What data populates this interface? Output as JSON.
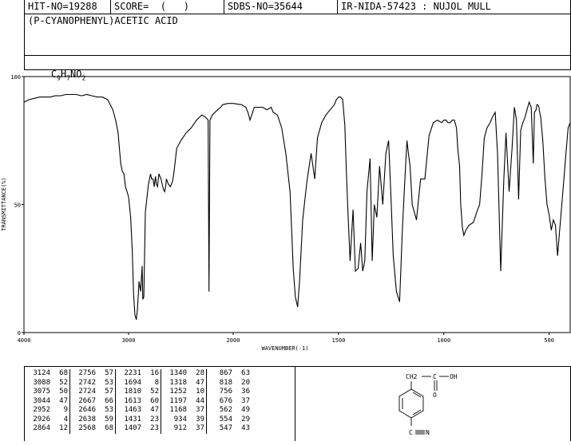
{
  "header": {
    "hit_no": "HIT-NO=19288",
    "score": "SCORE=  (   )",
    "sdbs_no": "SDBS-NO=35644",
    "ir_info": "IR-NIDA-57423 : NUJOL MULL"
  },
  "compound": {
    "name": "(P-CYANOPHENYL)ACETIC ACID",
    "formula": "C9H7NO2",
    "formula_parts": [
      "C",
      "9",
      "H",
      "7",
      "NO",
      "2"
    ]
  },
  "structure": {
    "ch2_label": "CH2",
    "c_label": "C",
    "oh_label": "OH",
    "o_label": "O",
    "c_nitrile": "C",
    "n_label": "N"
  },
  "chart_data": {
    "type": "line",
    "xlabel": "WAVENUMBER(-1)",
    "ylabel": "TRANSMITTANCE(%)",
    "xlim": [
      4000,
      400
    ],
    "ylim": [
      0,
      100
    ],
    "x_ticks": [
      "4000",
      "3000",
      "2000",
      "1500",
      "1000",
      "500"
    ],
    "y_ticks": [
      "100",
      "50",
      "0"
    ],
    "x_tick_values": [
      4000,
      3000,
      2000,
      1500,
      1000,
      500
    ],
    "y_tick_values": [
      100,
      50,
      0
    ],
    "x": [
      4000,
      3950,
      3900,
      3850,
      3800,
      3750,
      3700,
      3650,
      3600,
      3550,
      3500,
      3450,
      3400,
      3350,
      3300,
      3250,
      3200,
      3150,
      3124,
      3100,
      3088,
      3075,
      3060,
      3044,
      3030,
      3000,
      2980,
      2965,
      2952,
      2940,
      2926,
      2915,
      2900,
      2885,
      2870,
      2864,
      2854,
      2840,
      2810,
      2790,
      2780,
      2766,
      2756,
      2742,
      2735,
      2724,
      2710,
      2690,
      2667,
      2655,
      2646,
      2638,
      2620,
      2600,
      2580,
      2568,
      2540,
      2500,
      2450,
      2400,
      2350,
      2300,
      2260,
      2240,
      2231,
      2222,
      2200,
      2150,
      2120,
      2100,
      2050,
      2000,
      1960,
      1940,
      1930,
      1920,
      1900,
      1880,
      1860,
      1840,
      1820,
      1810,
      1790,
      1770,
      1750,
      1730,
      1715,
      1705,
      1694,
      1685,
      1670,
      1650,
      1630,
      1613,
      1600,
      1580,
      1560,
      1540,
      1520,
      1510,
      1500,
      1490,
      1480,
      1470,
      1463,
      1455,
      1445,
      1440,
      1431,
      1420,
      1407,
      1395,
      1385,
      1375,
      1365,
      1350,
      1340,
      1330,
      1318,
      1305,
      1290,
      1275,
      1262,
      1252,
      1240,
      1225,
      1210,
      1197,
      1185,
      1175,
      1168,
      1160,
      1150,
      1130,
      1110,
      1090,
      1070,
      1050,
      1030,
      1010,
      1000,
      990,
      980,
      970,
      960,
      950,
      940,
      934,
      925,
      920,
      912,
      905,
      895,
      880,
      860,
      840,
      830,
      818,
      808,
      795,
      780,
      770,
      756,
      745,
      730,
      715,
      705,
      690,
      676,
      665,
      655,
      645,
      635,
      625,
      615,
      605,
      595,
      585,
      575,
      570,
      562,
      558,
      554,
      548,
      547,
      540,
      530,
      520,
      510,
      500,
      490,
      480,
      470,
      460,
      450,
      440,
      430,
      420,
      410,
      400
    ],
    "y": [
      90,
      91,
      91.5,
      92,
      92,
      92,
      92.5,
      92.5,
      93,
      93,
      93,
      92.5,
      93,
      92.5,
      92,
      92,
      91,
      87,
      83,
      78,
      72,
      66,
      63,
      62,
      57,
      53,
      45,
      32,
      15,
      7,
      5,
      9,
      20,
      16,
      26,
      13,
      14,
      47,
      58,
      62,
      60,
      60,
      57,
      61,
      58,
      57,
      62,
      60,
      56,
      55,
      57,
      60,
      58,
      57,
      59,
      62,
      72,
      75,
      78,
      80,
      83,
      85,
      84,
      83,
      16,
      83,
      85,
      87,
      88,
      89,
      89.5,
      89.5,
      89,
      88,
      86,
      83,
      88,
      88,
      88,
      87,
      88,
      86,
      85,
      80,
      70,
      55,
      25,
      14,
      10,
      20,
      44,
      59,
      70,
      60,
      76,
      82,
      85,
      87,
      89,
      91,
      92,
      92,
      91,
      81,
      64,
      47,
      28,
      35,
      48,
      24,
      25,
      35,
      24,
      28,
      55,
      68,
      28,
      50,
      45,
      65,
      50,
      70,
      75,
      55,
      30,
      16,
      12,
      40,
      60,
      75,
      70,
      65,
      50,
      44,
      60,
      60,
      77,
      82,
      83,
      82,
      83,
      83,
      82,
      82,
      83,
      83,
      80,
      72,
      65,
      50,
      41,
      38,
      40,
      42,
      43,
      48,
      50,
      63,
      76,
      80,
      82,
      84,
      86,
      70,
      24,
      60,
      78,
      55,
      72,
      88,
      83,
      52,
      79,
      82,
      84,
      87,
      90,
      88,
      66,
      86,
      87,
      89,
      89,
      88,
      87,
      84,
      75,
      60,
      50,
      46,
      40,
      44,
      42,
      30,
      40,
      50,
      60,
      70,
      80,
      82,
      81,
      83,
      87,
      88,
      86,
      84,
      80,
      78,
      75,
      70,
      62,
      58,
      57,
      55
    ]
  },
  "peaks": [
    {
      "w": "3124",
      "t": "68"
    },
    {
      "w": "3088",
      "t": "52"
    },
    {
      "w": "3075",
      "t": "50"
    },
    {
      "w": "3044",
      "t": "47"
    },
    {
      "w": "2952",
      "t": "9"
    },
    {
      "w": "2926",
      "t": "4"
    },
    {
      "w": "2864",
      "t": "12"
    },
    {
      "w": "2756",
      "t": "57"
    },
    {
      "w": "2742",
      "t": "53"
    },
    {
      "w": "2724",
      "t": "57"
    },
    {
      "w": "2667",
      "t": "66"
    },
    {
      "w": "2646",
      "t": "53"
    },
    {
      "w": "2638",
      "t": "59"
    },
    {
      "w": "2568",
      "t": "68"
    },
    {
      "w": "2231",
      "t": "16"
    },
    {
      "w": "1694",
      "t": "8"
    },
    {
      "w": "1810",
      "t": "52"
    },
    {
      "w": "1613",
      "t": "60"
    },
    {
      "w": "1463",
      "t": "47"
    },
    {
      "w": "1431",
      "t": "23"
    },
    {
      "w": "1407",
      "t": "23"
    },
    {
      "w": "1340",
      "t": "28"
    },
    {
      "w": "1318",
      "t": "47"
    },
    {
      "w": "1252",
      "t": "10"
    },
    {
      "w": "1197",
      "t": "44"
    },
    {
      "w": "1168",
      "t": "37"
    },
    {
      "w": "934",
      "t": "39"
    },
    {
      "w": "912",
      "t": "37"
    },
    {
      "w": "867",
      "t": "63"
    },
    {
      "w": "818",
      "t": "20"
    },
    {
      "w": "756",
      "t": "36"
    },
    {
      "w": "676",
      "t": "37"
    },
    {
      "w": "562",
      "t": "49"
    },
    {
      "w": "554",
      "t": "29"
    },
    {
      "w": "547",
      "t": "43"
    }
  ]
}
